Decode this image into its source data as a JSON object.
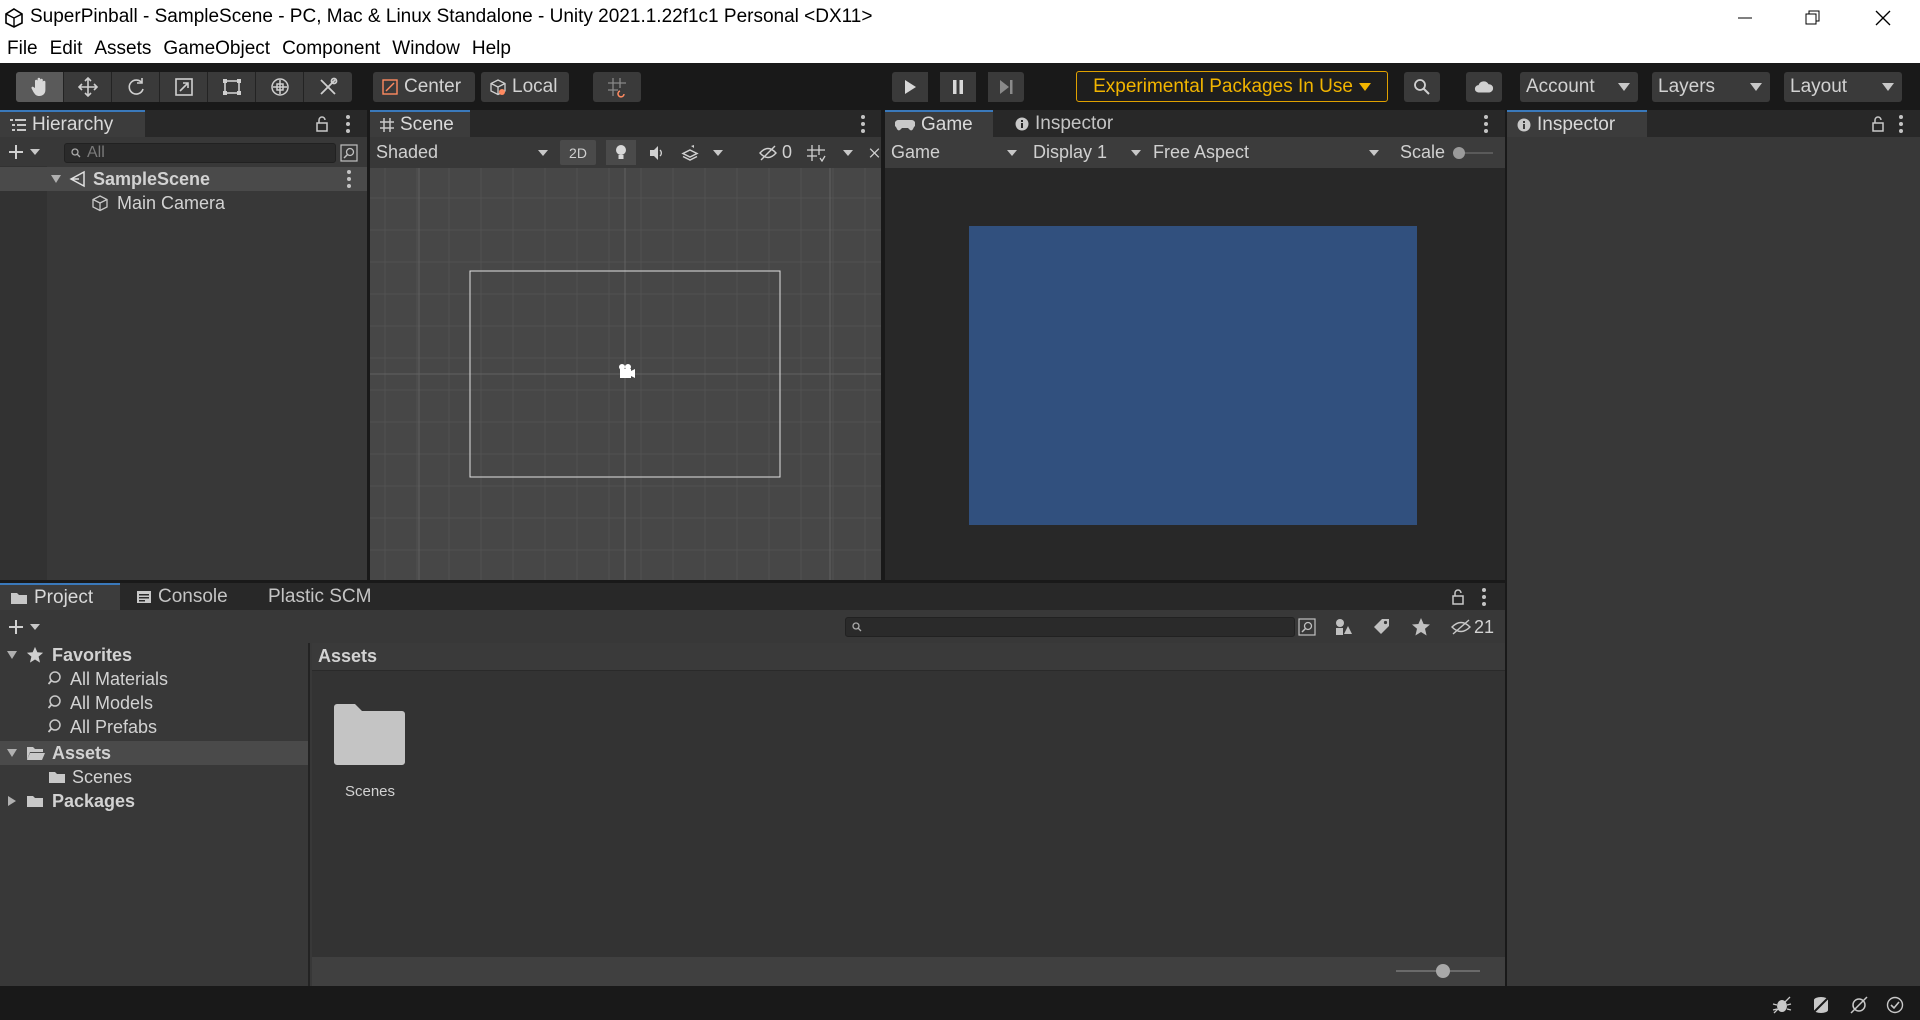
{
  "window": {
    "title": "SuperPinball - SampleScene - PC, Mac & Linux Standalone - Unity 2021.1.22f1c1 Personal <DX11>",
    "controls": [
      "minimize-icon",
      "restore-icon",
      "close-icon"
    ]
  },
  "menu": [
    "File",
    "Edit",
    "Assets",
    "GameObject",
    "Component",
    "Window",
    "Help"
  ],
  "toolbar": {
    "tools": [
      "hand-icon",
      "move-icon",
      "rotate-icon",
      "scale-icon",
      "rect-icon",
      "transform-icon",
      "custom-tool-icon"
    ],
    "pivot_center": "Center",
    "pivot_local": "Local",
    "experimental": "Experimental Packages In Use",
    "account": "Account",
    "layers": "Layers",
    "layout": "Layout"
  },
  "hierarchy": {
    "tab": "Hierarchy",
    "search_placeholder": "All",
    "scene": "SampleScene",
    "items": [
      "Main Camera"
    ]
  },
  "scene": {
    "tab": "Scene",
    "shading": "Shaded",
    "mode_2d": "2D",
    "hidden_count": "0"
  },
  "game": {
    "tab": "Game",
    "inspector_tab": "Inspector",
    "view_mode": "Game",
    "display": "Display 1",
    "aspect": "Free Aspect",
    "scale_label": "Scale",
    "background_color": "#31507e"
  },
  "inspector": {
    "tab": "Inspector"
  },
  "project": {
    "tabs": [
      "Project",
      "Console",
      "Plastic SCM"
    ],
    "hidden_packages_count": "21",
    "favorites": {
      "label": "Favorites",
      "items": [
        "All Materials",
        "All Models",
        "All Prefabs"
      ]
    },
    "assets_label": "Assets",
    "assets_children": [
      "Scenes"
    ],
    "packages_label": "Packages",
    "content_header": "Assets",
    "content_items": [
      "Scenes"
    ]
  },
  "colors": {
    "accent_tab": "#3a79bb",
    "experimental": "#f2b500"
  }
}
